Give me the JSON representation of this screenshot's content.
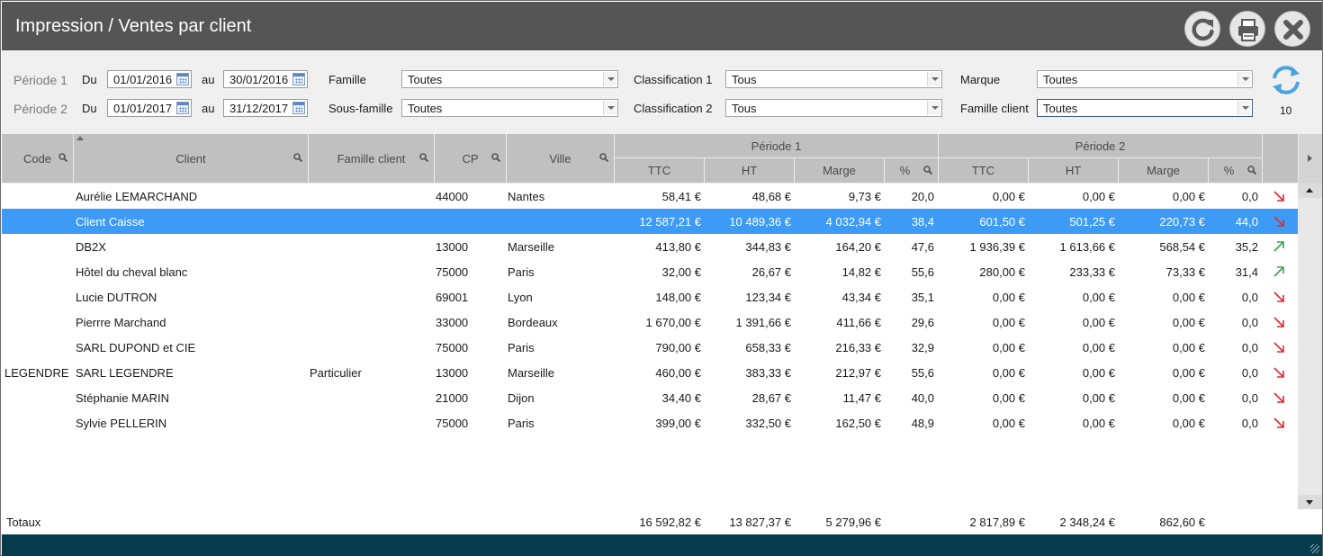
{
  "window": {
    "title": "Impression / Ventes par client",
    "buttons": {
      "refresh": "refresh-icon",
      "print": "printer-icon",
      "close": "close-icon"
    }
  },
  "filters": {
    "period1": {
      "label": "Période 1",
      "du_label": "Du",
      "from": "01/01/2016",
      "au_label": "au",
      "to": "30/01/2016"
    },
    "period2": {
      "label": "Période 2",
      "du_label": "Du",
      "from": "01/01/2017",
      "au_label": "au",
      "to": "31/12/2017"
    },
    "famille": {
      "label": "Famille",
      "value": "Toutes"
    },
    "sous_famille": {
      "label": "Sous-famille",
      "value": "Toutes"
    },
    "classification1": {
      "label": "Classification 1",
      "value": "Tous"
    },
    "classification2": {
      "label": "Classification 2",
      "value": "Tous"
    },
    "marque": {
      "label": "Marque",
      "value": "Toutes"
    },
    "famille_client": {
      "label": "Famille client",
      "value": "Toutes"
    },
    "result_count": "10"
  },
  "table": {
    "headers": {
      "code": "Code",
      "client": "Client",
      "famille_client": "Famille client",
      "cp": "CP",
      "ville": "Ville",
      "periode1": "Période 1",
      "periode2": "Période 2",
      "ttc": "TTC",
      "ht": "HT",
      "marge": "Marge",
      "pct": "%"
    },
    "rows": [
      {
        "code": "",
        "client": "Aurélie LEMARCHAND",
        "famille": "",
        "cp": "44000",
        "ville": "Nantes",
        "p1_ttc": "58,41 €",
        "p1_ht": "48,68 €",
        "p1_marge": "9,73 €",
        "p1_pct": "20,0",
        "p2_ttc": "0,00 €",
        "p2_ht": "0,00 €",
        "p2_marge": "0,00 €",
        "p2_pct": "0,0",
        "trend": "down"
      },
      {
        "code": "",
        "client": "Client Caisse",
        "famille": "",
        "cp": "",
        "ville": "",
        "p1_ttc": "12 587,21 €",
        "p1_ht": "10 489,36 €",
        "p1_marge": "4 032,94 €",
        "p1_pct": "38,4",
        "p2_ttc": "601,50 €",
        "p2_ht": "501,25 €",
        "p2_marge": "220,73 €",
        "p2_pct": "44,0",
        "trend": "down"
      },
      {
        "code": "",
        "client": "DB2X",
        "famille": "",
        "cp": "13000",
        "ville": "Marseille",
        "p1_ttc": "413,80 €",
        "p1_ht": "344,83 €",
        "p1_marge": "164,20 €",
        "p1_pct": "47,6",
        "p2_ttc": "1 936,39 €",
        "p2_ht": "1 613,66 €",
        "p2_marge": "568,54 €",
        "p2_pct": "35,2",
        "trend": "up"
      },
      {
        "code": "",
        "client": "Hôtel du cheval blanc",
        "famille": "",
        "cp": "75000",
        "ville": "Paris",
        "p1_ttc": "32,00 €",
        "p1_ht": "26,67 €",
        "p1_marge": "14,82 €",
        "p1_pct": "55,6",
        "p2_ttc": "280,00 €",
        "p2_ht": "233,33 €",
        "p2_marge": "73,33 €",
        "p2_pct": "31,4",
        "trend": "up"
      },
      {
        "code": "",
        "client": "Lucie DUTRON",
        "famille": "",
        "cp": "69001",
        "ville": "Lyon",
        "p1_ttc": "148,00 €",
        "p1_ht": "123,34 €",
        "p1_marge": "43,34 €",
        "p1_pct": "35,1",
        "p2_ttc": "0,00 €",
        "p2_ht": "0,00 €",
        "p2_marge": "0,00 €",
        "p2_pct": "0,0",
        "trend": "down"
      },
      {
        "code": "",
        "client": "Pierrre Marchand",
        "famille": "",
        "cp": "33000",
        "ville": "Bordeaux",
        "p1_ttc": "1 670,00 €",
        "p1_ht": "1 391,66 €",
        "p1_marge": "411,66 €",
        "p1_pct": "29,6",
        "p2_ttc": "0,00 €",
        "p2_ht": "0,00 €",
        "p2_marge": "0,00 €",
        "p2_pct": "0,0",
        "trend": "down"
      },
      {
        "code": "",
        "client": "SARL DUPOND et CIE",
        "famille": "",
        "cp": "75000",
        "ville": "Paris",
        "p1_ttc": "790,00 €",
        "p1_ht": "658,33 €",
        "p1_marge": "216,33 €",
        "p1_pct": "32,9",
        "p2_ttc": "0,00 €",
        "p2_ht": "0,00 €",
        "p2_marge": "0,00 €",
        "p2_pct": "0,0",
        "trend": "down"
      },
      {
        "code": "LEGENDRE",
        "client": "SARL LEGENDRE",
        "famille": "Particulier",
        "cp": "13000",
        "ville": "Marseille",
        "p1_ttc": "460,00 €",
        "p1_ht": "383,33 €",
        "p1_marge": "212,97 €",
        "p1_pct": "55,6",
        "p2_ttc": "0,00 €",
        "p2_ht": "0,00 €",
        "p2_marge": "0,00 €",
        "p2_pct": "0,0",
        "trend": "down"
      },
      {
        "code": "",
        "client": "Stéphanie MARIN",
        "famille": "",
        "cp": "21000",
        "ville": "Dijon",
        "p1_ttc": "34,40 €",
        "p1_ht": "28,67 €",
        "p1_marge": "11,47 €",
        "p1_pct": "40,0",
        "p2_ttc": "0,00 €",
        "p2_ht": "0,00 €",
        "p2_marge": "0,00 €",
        "p2_pct": "0,0",
        "trend": "down"
      },
      {
        "code": "",
        "client": "Sylvie PELLERIN",
        "famille": "",
        "cp": "75000",
        "ville": "Paris",
        "p1_ttc": "399,00 €",
        "p1_ht": "332,50 €",
        "p1_marge": "162,50 €",
        "p1_pct": "48,9",
        "p2_ttc": "0,00 €",
        "p2_ht": "0,00 €",
        "p2_marge": "0,00 €",
        "p2_pct": "0,0",
        "trend": "down"
      }
    ],
    "selected_row": 1,
    "totals": {
      "label": "Totaux",
      "p1_ttc": "16 592,82 €",
      "p1_ht": "13 827,37 €",
      "p1_marge": "5 279,96 €",
      "p2_ttc": "2 817,89 €",
      "p2_ht": "2 348,24 €",
      "p2_marge": "862,60 €"
    }
  },
  "colors": {
    "titlebar": "#555555",
    "selection": "#3d9bf5",
    "trend_down": "#e0282e",
    "trend_up": "#3aa04a",
    "footer": "#053b4a"
  }
}
